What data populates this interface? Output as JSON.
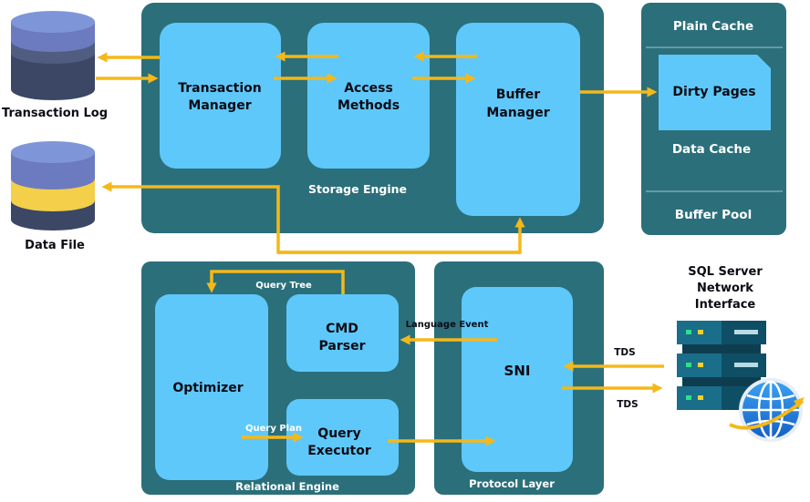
{
  "colors": {
    "panel": "#2b6f7b",
    "box": "#5ec8fa",
    "arrow": "#f5b818"
  },
  "storage_engine": {
    "label": "Storage Engine",
    "transaction_manager": [
      "Transaction",
      "Manager"
    ],
    "access_methods": [
      "Access",
      "Methods"
    ],
    "buffer_manager": [
      "Buffer",
      "Manager"
    ]
  },
  "buffer_pool": {
    "plain_cache": "Plain Cache",
    "dirty_pages": "Dirty Pages",
    "data_cache": "Data Cache",
    "label": "Buffer Pool"
  },
  "stores": {
    "transaction_log": "Transaction Log",
    "data_file": "Data File"
  },
  "relational_engine": {
    "label": "Relational Engine",
    "optimizer": "Optimizer",
    "cmd_parser": [
      "CMD",
      "Parser"
    ],
    "query_executor": [
      "Query",
      "Executor"
    ],
    "query_tree": "Query Tree",
    "query_plan": "Query Plan"
  },
  "protocol_layer": {
    "label": "Protocol Layer",
    "sni": "SNI",
    "language_event": "Language Event"
  },
  "network": {
    "title": [
      "SQL Server",
      "Network",
      "Interface"
    ],
    "tds_in": "TDS",
    "tds_out": "TDS",
    "icons": [
      "server-icon",
      "globe-icon"
    ]
  }
}
